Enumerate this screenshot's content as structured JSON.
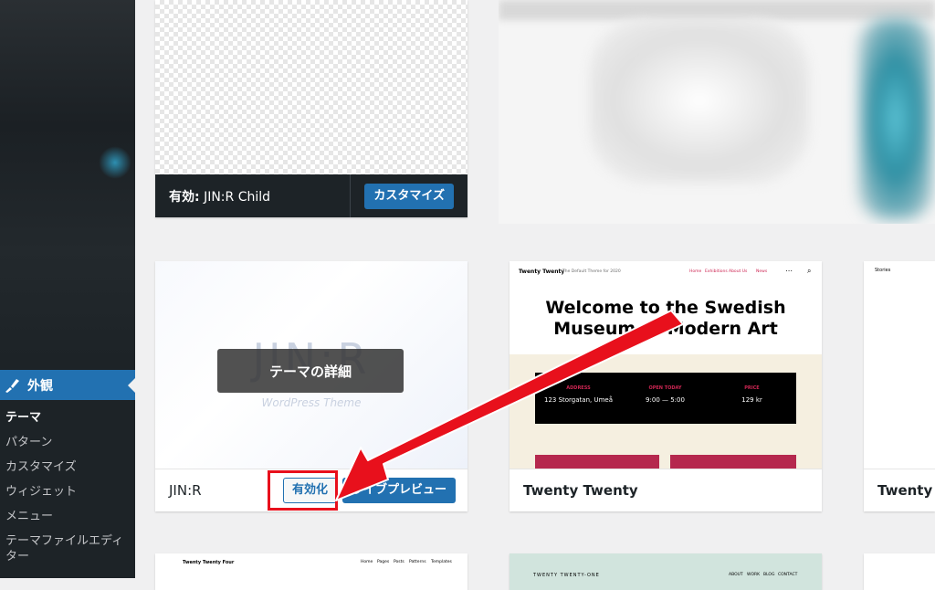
{
  "sidebar": {
    "active_menu": "外観",
    "submenu": [
      {
        "label": "テーマ",
        "current": true
      },
      {
        "label": "パターン",
        "current": false
      },
      {
        "label": "カスタマイズ",
        "current": false
      },
      {
        "label": "ウィジェット",
        "current": false
      },
      {
        "label": "メニュー",
        "current": false
      },
      {
        "label": "テーマファイルエディター",
        "current": false
      }
    ]
  },
  "themes": {
    "active": {
      "prefix": "有効:",
      "name": "JIN:R Child",
      "customize_label": "カスタマイズ"
    },
    "jinr": {
      "name": "JIN:R",
      "logo_text": "JIN:R",
      "logo_sub": "WordPress Theme",
      "detail_label": "テーマの詳細",
      "activate_label": "有効化",
      "live_preview_label": "ライブプレビュー"
    },
    "twenty_twenty": {
      "name": "Twenty Twenty",
      "site_title": "Twenty Twenty",
      "tagline": "The Default Theme for 2020",
      "nav": [
        "Home",
        "Exhibitions",
        "About Us",
        "News"
      ],
      "hero": "Welcome to the Swedish Museum of Modern Art",
      "info": [
        {
          "heading": "ADDRESS",
          "value": "123 Storgatan, Umeå"
        },
        {
          "heading": "OPEN TODAY",
          "value": "9:00 — 5:00"
        },
        {
          "heading": "PRICE",
          "value": "129 kr"
        }
      ]
    },
    "twenty_twenty_partial": {
      "name": "Twenty Tw",
      "preview_label": "Stories"
    },
    "twenty_twenty_four": {
      "site_title": "Twenty Twenty Four",
      "nav": [
        "Home",
        "Pages",
        "Posts",
        "Patterns",
        "Templates"
      ]
    },
    "twenty_twenty_one": {
      "site_title": "TWENTY TWENTY-ONE",
      "nav": [
        "ABOUT",
        "WORK",
        "BLOG",
        "CONTACT"
      ]
    }
  },
  "colors": {
    "sidebar_bg": "#1d2327",
    "accent": "#2271b1",
    "annotation_red": "#e8101c"
  }
}
